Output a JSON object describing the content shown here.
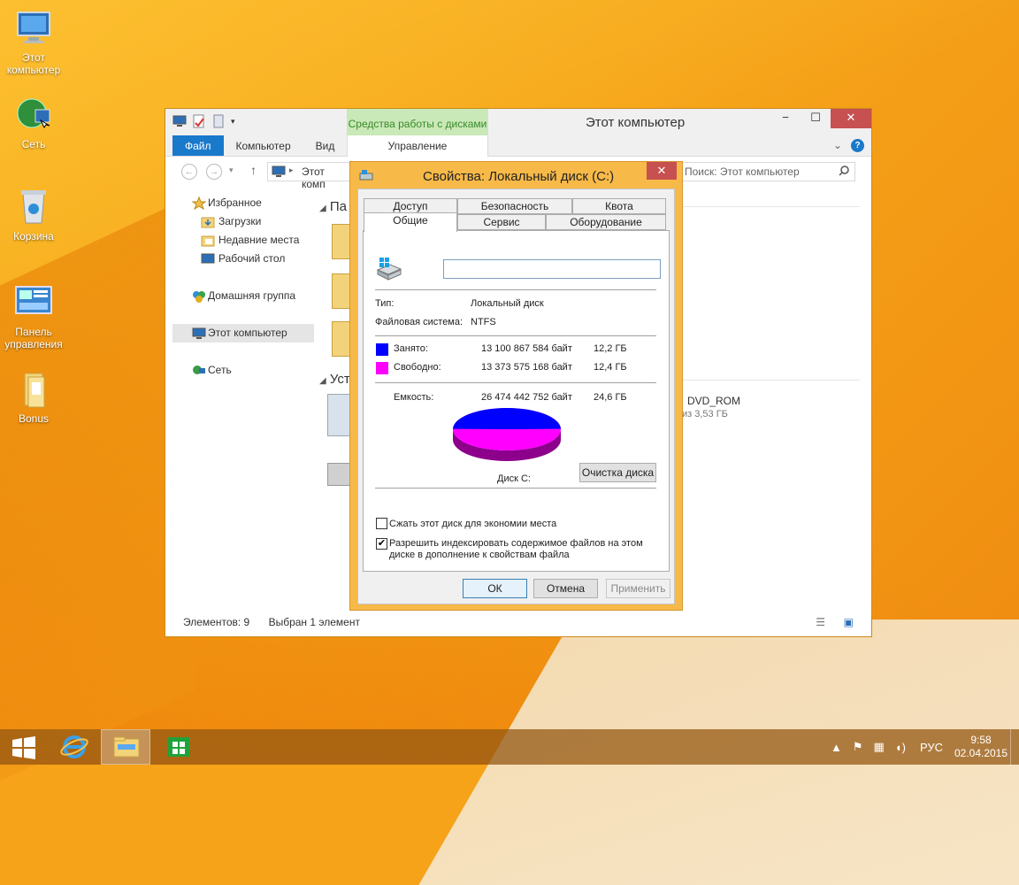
{
  "desktop": {
    "icons": [
      {
        "label": "Этот компьютер"
      },
      {
        "label": "Сеть"
      },
      {
        "label": "Корзина"
      },
      {
        "label": "Панель управления"
      },
      {
        "label": "Bonus"
      }
    ]
  },
  "explorer": {
    "title": "Этот компьютер",
    "context_tab": "Средства работы с дисками",
    "ribbon_tabs": [
      "Файл",
      "Компьютер",
      "Вид"
    ],
    "manage_tab": "Управление",
    "address": "Этот комп",
    "search_placeholder": "Поиск: Этот компьютер",
    "nav": {
      "favorites": "Избранное",
      "downloads": "Загрузки",
      "recent": "Недавние места",
      "desktop": "Рабочий стол",
      "homegroup": "Домашняя группа",
      "this_pc": "Этот компьютер",
      "network": "Сеть"
    },
    "content": {
      "folders_header": "Па",
      "devices_header": "Уст",
      "dvd_name": "DVD_ROM",
      "dvd_size": "из 3,53 ГБ"
    },
    "status": {
      "items": "Элементов: 9",
      "selected": "Выбран 1 элемент"
    }
  },
  "dialog": {
    "title": "Свойства: Локальный диск (C:)",
    "tabs_top": [
      "Доступ",
      "Безопасность",
      "Квота"
    ],
    "tabs_bottom": [
      "Общие",
      "Сервис",
      "Оборудование"
    ],
    "name_value": "",
    "type_label": "Тип:",
    "type_value": "Локальный диск",
    "fs_label": "Файловая система:",
    "fs_value": "NTFS",
    "used_label": "Занято:",
    "used_bytes": "13 100 867 584 байт",
    "used_gb": "12,2 ГБ",
    "free_label": "Свободно:",
    "free_bytes": "13 373 575 168 байт",
    "free_gb": "12,4 ГБ",
    "capacity_label": "Емкость:",
    "capacity_bytes": "26 474 442 752 байт",
    "capacity_gb": "24,6 ГБ",
    "disk_label": "Диск C:",
    "cleanup_button": "Очистка диска",
    "compress_label": "Сжать этот диск для экономии места",
    "compress_checked": false,
    "index_label_1": "Разрешить индексировать содержимое файлов на этом",
    "index_label_2": "диске в дополнение к свойствам файла",
    "index_checked": true,
    "ok": "ОК",
    "cancel": "Отмена",
    "apply": "Применить",
    "colors": {
      "used": "#0000ff",
      "free": "#ff00ff"
    },
    "used_fraction": 0.495
  },
  "taskbar": {
    "lang": "РУС",
    "time": "9:58",
    "date": "02.04.2015"
  }
}
